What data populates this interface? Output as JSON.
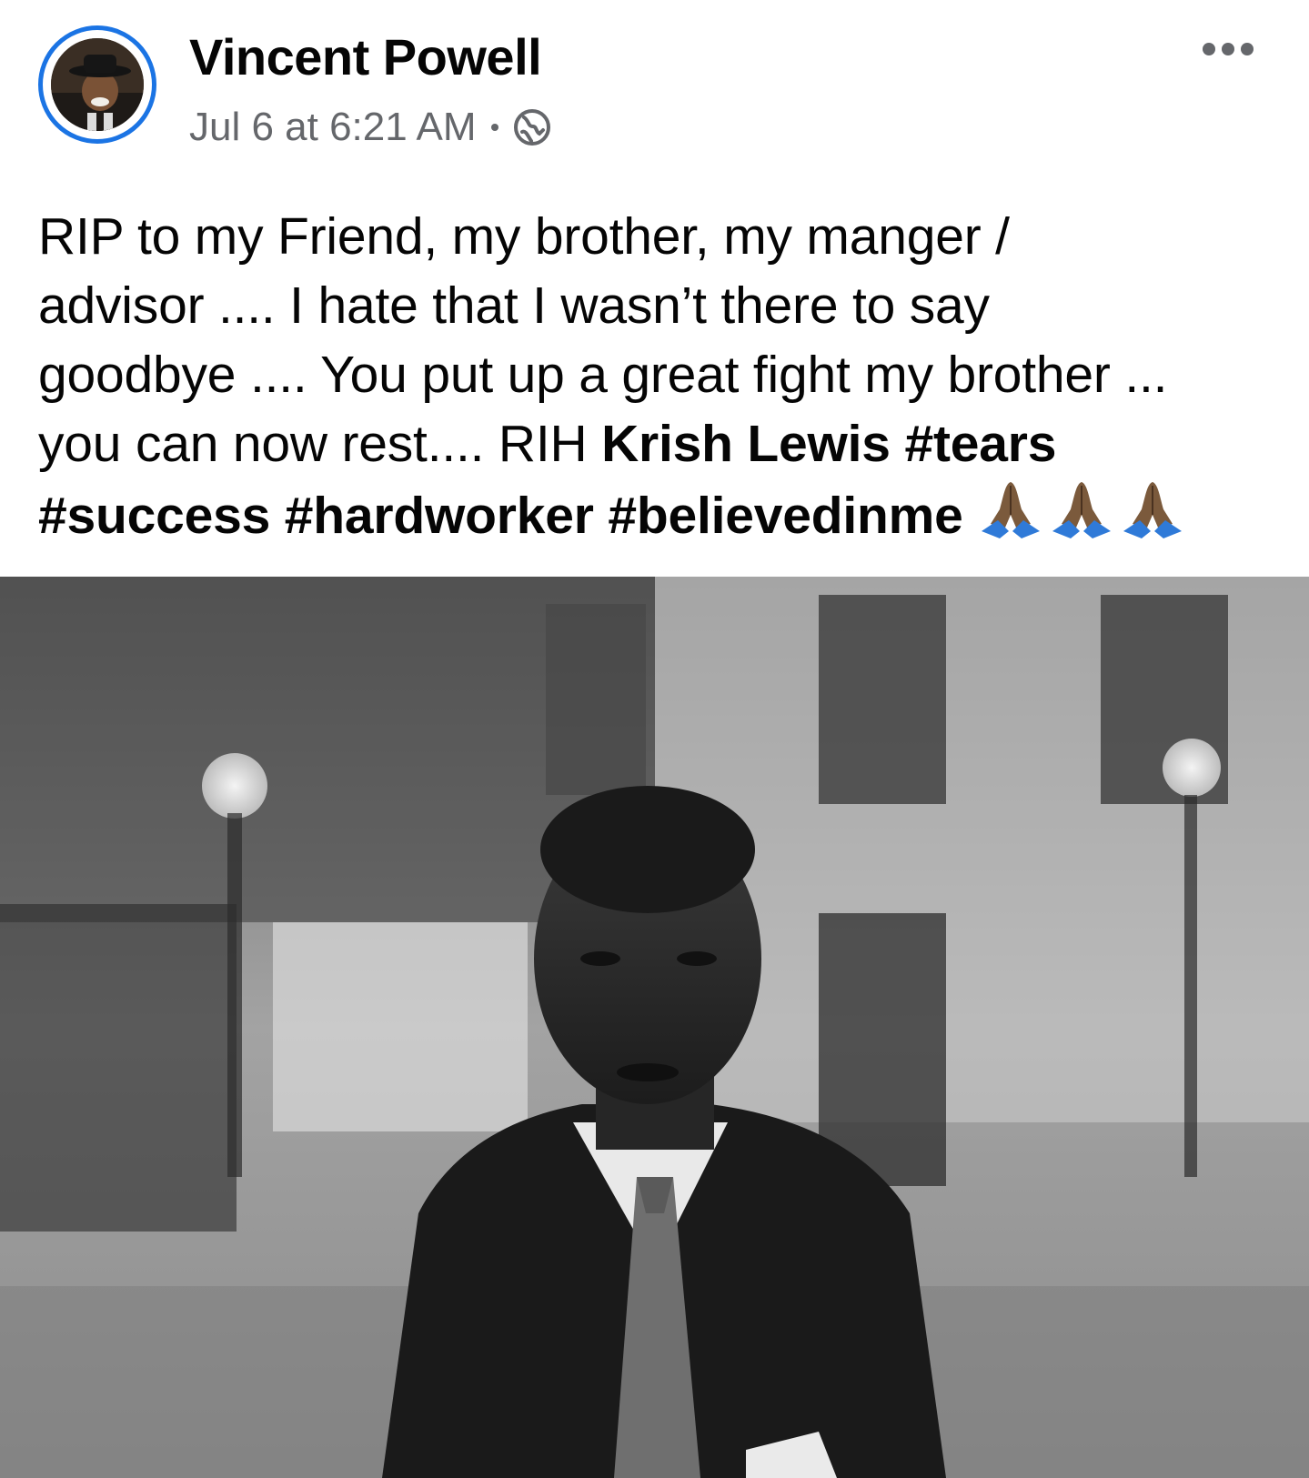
{
  "post": {
    "author": {
      "name": "Vincent Powell",
      "avatar_icon": "profile-photo"
    },
    "timestamp": "Jul 6 at 6:21 AM",
    "privacy_icon": "globe-icon",
    "more_icon": "more-options-icon",
    "text": {
      "line1": "RIP to my Friend, my brother, my manger /",
      "line2": "advisor .... I hate that I wasn’t there to say",
      "line3": "goodbye .... You put up a great fight my brother ...",
      "line4_prefix": "you can now rest.... RIH ",
      "tagged_person": "Krish Lewis",
      "hashtags": [
        "#tears",
        "#success",
        "#hardworker",
        "#believedinme"
      ],
      "emoji": [
        "pray-emoji",
        "pray-emoji",
        "pray-emoji"
      ]
    },
    "photo": {
      "kind": "black-and-white portrait photo"
    }
  },
  "colors": {
    "avatar_ring": "#1b74e4",
    "meta_text": "#65676b",
    "body_text": "#050505"
  }
}
